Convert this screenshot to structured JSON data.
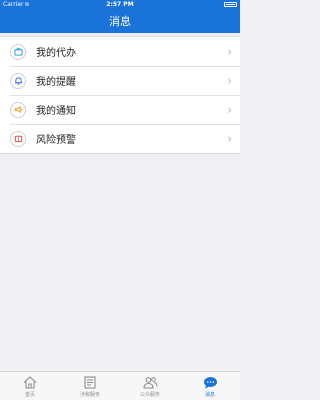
{
  "status_bar": {
    "carrier": "Carrier",
    "time": "2:57 PM"
  },
  "header": {
    "title": "消息"
  },
  "menu": {
    "items": [
      {
        "label": "我的代办",
        "icon": "briefcase-icon",
        "color": "#3aa6e6"
      },
      {
        "label": "我的提醒",
        "icon": "bell-icon",
        "color": "#4a7fe0"
      },
      {
        "label": "我的通知",
        "icon": "megaphone-icon",
        "color": "#f0a020"
      },
      {
        "label": "风险预警",
        "icon": "warning-icon",
        "color": "#e05050"
      }
    ]
  },
  "tab_bar": {
    "items": [
      {
        "label": "首页",
        "icon": "home-icon",
        "active": false
      },
      {
        "label": "涉税服务",
        "icon": "document-icon",
        "active": false
      },
      {
        "label": "公众服务",
        "icon": "people-icon",
        "active": false
      },
      {
        "label": "消息",
        "icon": "chat-icon",
        "active": true
      }
    ],
    "active_color": "#1a73d9"
  },
  "colors": {
    "primary": "#1a73d9",
    "background": "#efeff4"
  }
}
